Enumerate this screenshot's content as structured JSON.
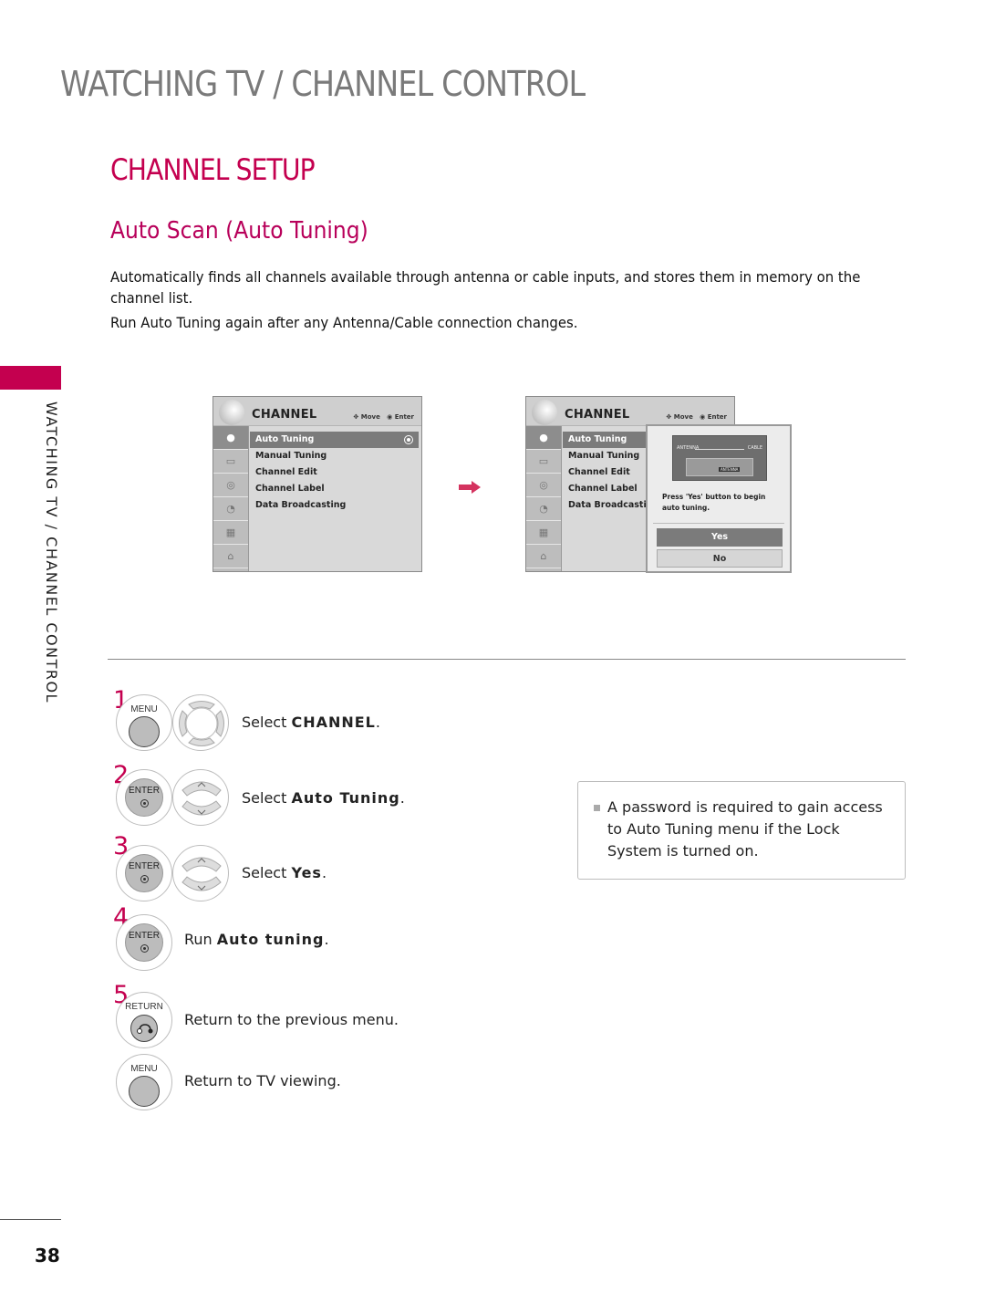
{
  "page": {
    "header": "WATCHING TV / CHANNEL CONTROL",
    "side_label": "WATCHING TV / CHANNEL CONTROL",
    "section_title": "CHANNEL SETUP",
    "sub_title": "Auto Scan (Auto Tuning)",
    "intro": [
      "Automatically finds all channels available through antenna or cable inputs, and stores them in memory on the",
      "channel list.",
      "Run Auto Tuning again after any Antenna/Cable connection changes."
    ],
    "page_number": "38",
    "accent_color": "#c4004f"
  },
  "tv_menu_1": {
    "title": "CHANNEL",
    "hint_move": "Move",
    "hint_enter": "Enter",
    "items": [
      "Auto Tuning",
      "Manual Tuning",
      "Channel Edit",
      "Channel Label",
      "Data Broadcasting"
    ],
    "selected": "Auto Tuning",
    "rail_icons": [
      "channel-icon",
      "picture-icon",
      "audio-icon",
      "time-icon",
      "option-icon",
      "lock-icon"
    ]
  },
  "tv_menu_2": {
    "title": "CHANNEL",
    "hint_move": "Move",
    "hint_enter": "Enter",
    "items": [
      "Auto Tuning",
      "Manual Tuning",
      "Channel Edit",
      "Channel Label",
      "Data Broadcastin"
    ],
    "popup": {
      "diagram_antenna": "ANTENNA",
      "diagram_cable": "CABLE",
      "diagram_port": "ANTENNA",
      "message_line1": "Press 'Yes' button to begin",
      "message_line2": "auto tuning.",
      "yes_label": "Yes",
      "no_label": "No"
    }
  },
  "steps": [
    {
      "num": "1",
      "button": "MENU",
      "prefix": "Select ",
      "bold": "CHANNEL",
      "suffix": "."
    },
    {
      "num": "2",
      "button": "ENTER",
      "prefix": "Select ",
      "bold": "Auto Tuning",
      "suffix": "."
    },
    {
      "num": "3",
      "button": "ENTER",
      "prefix": "Select ",
      "bold": "Yes",
      "suffix": "."
    },
    {
      "num": "4",
      "button": "ENTER",
      "prefix": "Run ",
      "bold": "Auto tuning",
      "suffix": "."
    },
    {
      "num": "5",
      "button": "RETURN",
      "text": "Return to the previous menu."
    },
    {
      "num": "",
      "button": "MENU",
      "text": "Return to TV viewing."
    }
  ],
  "note": {
    "text": "A password is required to gain access to Auto Tuning menu if the Lock System is turned on."
  }
}
